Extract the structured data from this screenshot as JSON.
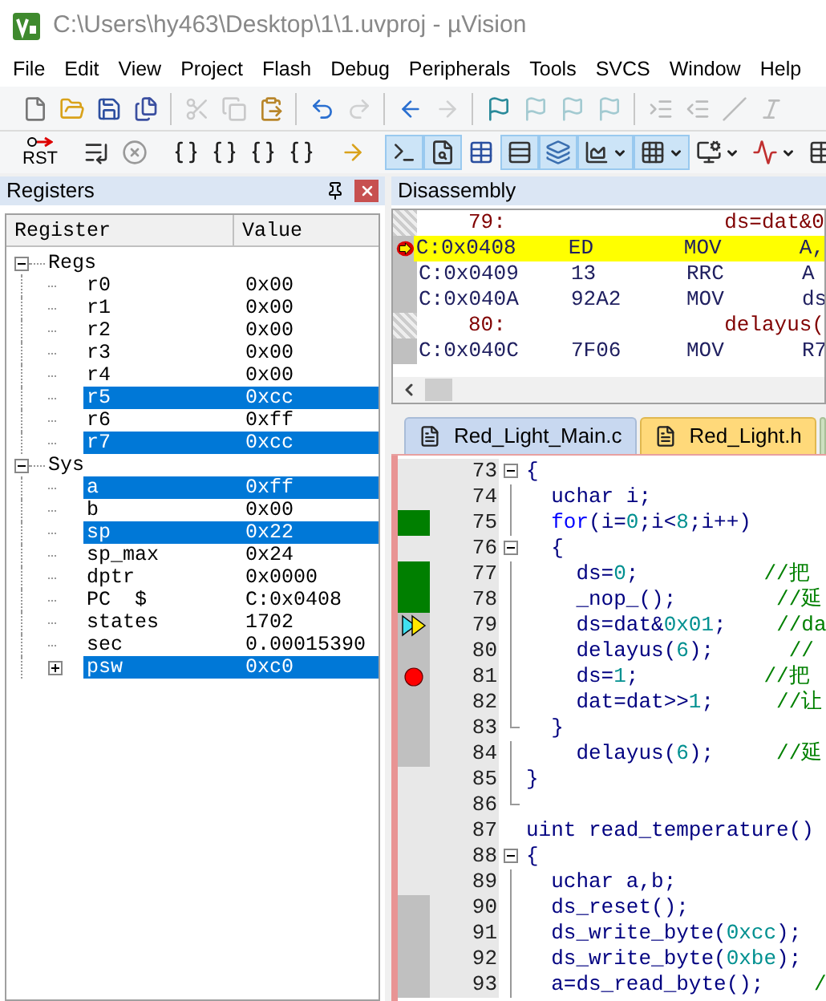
{
  "window": {
    "title": "C:\\Users\\hy463\\Desktop\\1\\1.uvproj - µVision"
  },
  "menu": [
    "File",
    "Edit",
    "View",
    "Project",
    "Flash",
    "Debug",
    "Peripherals",
    "Tools",
    "SVCS",
    "Window",
    "Help"
  ],
  "toolbar_1": [
    [
      {
        "kind": "new-file",
        "disabled": false
      },
      {
        "kind": "open-file",
        "disabled": false
      },
      {
        "kind": "save",
        "disabled": false
      },
      {
        "kind": "save-all",
        "disabled": false
      }
    ],
    [
      {
        "kind": "cut",
        "disabled": true
      },
      {
        "kind": "copy",
        "disabled": true
      },
      {
        "kind": "paste",
        "disabled": false
      }
    ],
    [
      {
        "kind": "undo",
        "disabled": false
      },
      {
        "kind": "redo",
        "disabled": true
      }
    ],
    [
      {
        "kind": "back",
        "disabled": false
      },
      {
        "kind": "forward",
        "disabled": true
      }
    ],
    [
      {
        "kind": "bookmark",
        "disabled": false
      },
      {
        "kind": "bookmark",
        "disabled": true
      },
      {
        "kind": "bookmark",
        "disabled": true
      },
      {
        "kind": "bookmark",
        "disabled": true
      }
    ],
    [
      {
        "kind": "indent",
        "disabled": true
      },
      {
        "kind": "outdent",
        "disabled": true
      },
      {
        "kind": "comment",
        "disabled": true
      },
      {
        "kind": "uncomment",
        "disabled": true
      }
    ]
  ],
  "toolbar_2": [
    [
      {
        "kind": "reset",
        "label": "RST",
        "selected": false
      }
    ],
    [
      {
        "kind": "step-list",
        "selected": false
      },
      {
        "kind": "stop",
        "selected": false
      }
    ],
    [
      {
        "kind": "step-in",
        "selected": false
      },
      {
        "kind": "step-over",
        "selected": false
      },
      {
        "kind": "step-out",
        "selected": false
      },
      {
        "kind": "run-to",
        "selected": false
      }
    ],
    [
      {
        "kind": "show-next",
        "selected": false
      }
    ],
    [
      {
        "kind": "command",
        "selected": true
      },
      {
        "kind": "disassembly",
        "selected": true
      },
      {
        "kind": "symbols",
        "selected": false
      },
      {
        "kind": "registers",
        "selected": true
      },
      {
        "kind": "call-stack",
        "selected": true
      },
      {
        "kind": "watch",
        "selected": true
      },
      {
        "kind": "memory",
        "selected": true
      },
      {
        "kind": "serial",
        "selected": false
      },
      {
        "kind": "analyzer",
        "selected": false
      },
      {
        "kind": "more",
        "selected": false
      }
    ]
  ],
  "registers": {
    "title": "Registers",
    "columns": [
      "Register",
      "Value"
    ],
    "groups": [
      {
        "name": "Regs",
        "expanded": true,
        "children": [
          {
            "name": "r0",
            "value": "0x00",
            "selected": false
          },
          {
            "name": "r1",
            "value": "0x00",
            "selected": false
          },
          {
            "name": "r2",
            "value": "0x00",
            "selected": false
          },
          {
            "name": "r3",
            "value": "0x00",
            "selected": false
          },
          {
            "name": "r4",
            "value": "0x00",
            "selected": false
          },
          {
            "name": "r5",
            "value": "0xcc",
            "selected": true
          },
          {
            "name": "r6",
            "value": "0xff",
            "selected": false
          },
          {
            "name": "r7",
            "value": "0xcc",
            "selected": true
          }
        ]
      },
      {
        "name": "Sys",
        "expanded": true,
        "children": [
          {
            "name": "a",
            "value": "0xff",
            "selected": true
          },
          {
            "name": "b",
            "value": "0x00",
            "selected": false
          },
          {
            "name": "sp",
            "value": "0x22",
            "selected": true
          },
          {
            "name": "sp_max",
            "value": "0x24",
            "selected": false
          },
          {
            "name": "dptr",
            "value": "0x0000",
            "selected": false
          },
          {
            "name": "PC  $",
            "value": "C:0x0408",
            "selected": false
          },
          {
            "name": "states",
            "value": "1702",
            "selected": false
          },
          {
            "name": "sec",
            "value": "0.00015390",
            "selected": false
          },
          {
            "name": "psw",
            "value": "0xc0",
            "selected": true,
            "expanded": false
          }
        ]
      }
    ]
  },
  "disassembly": {
    "title": "Disassembly",
    "rows": [
      {
        "kind": "source",
        "line": "79:",
        "text": "ds=dat&0"
      },
      {
        "kind": "instr",
        "address": "C:0x0408",
        "bytes": "ED",
        "mnemonic": "MOV",
        "operand": "A,",
        "current": true
      },
      {
        "kind": "instr",
        "address": "C:0x0409",
        "bytes": "13",
        "mnemonic": "RRC",
        "operand": "A",
        "current": false
      },
      {
        "kind": "instr",
        "address": "C:0x040A",
        "bytes": "92A2",
        "mnemonic": "MOV",
        "operand": "ds",
        "current": false
      },
      {
        "kind": "source",
        "line": "80:",
        "text": "delayus("
      },
      {
        "kind": "instr",
        "address": "C:0x040C",
        "bytes": "7F06",
        "mnemonic": "MOV",
        "operand": "R7",
        "current": false
      }
    ]
  },
  "tabs": [
    {
      "label": "Red_Light_Main.c",
      "selected": false
    },
    {
      "label": "Red_Light.h",
      "selected": true
    }
  ],
  "editor": {
    "lines": [
      {
        "number": "73",
        "covered": false,
        "executed": false,
        "kind": "fold-start",
        "tokens": [
          {
            "t": "{",
            "kind": "plain"
          }
        ]
      },
      {
        "number": "74",
        "covered": false,
        "executed": false,
        "kind": "fold-line",
        "tokens": [
          {
            "t": "  uchar i;",
            "kind": "plain"
          }
        ]
      },
      {
        "number": "75",
        "covered": true,
        "executed": true,
        "kind": "fold-line",
        "tokens": [
          {
            "t": "  for",
            "kind": "keyword"
          },
          {
            "t": "(i=",
            "kind": "plain"
          },
          {
            "t": "0",
            "kind": "number"
          },
          {
            "t": ";i<",
            "kind": "plain"
          },
          {
            "t": "8",
            "kind": "number"
          },
          {
            "t": ";i++)",
            "kind": "plain"
          }
        ]
      },
      {
        "number": "76",
        "covered": false,
        "executed": false,
        "kind": "fold-start",
        "tokens": [
          {
            "t": "  {",
            "kind": "plain"
          }
        ]
      },
      {
        "number": "77",
        "covered": true,
        "executed": true,
        "kind": "fold-line",
        "tokens": [
          {
            "t": "    ds=",
            "kind": "plain"
          },
          {
            "t": "0",
            "kind": "number"
          },
          {
            "t": ";          ",
            "kind": "plain"
          },
          {
            "t": "//把",
            "kind": "comment"
          }
        ]
      },
      {
        "number": "78",
        "covered": true,
        "executed": true,
        "kind": "fold-line",
        "tokens": [
          {
            "t": "    _nop_();        ",
            "kind": "plain"
          },
          {
            "t": "//延",
            "kind": "comment"
          }
        ]
      },
      {
        "number": "79",
        "covered": false,
        "executed": true,
        "kind": "fold-line",
        "current": true,
        "tokens": [
          {
            "t": "    ds=dat&",
            "kind": "plain"
          },
          {
            "t": "0x01",
            "kind": "number"
          },
          {
            "t": ";    ",
            "kind": "plain"
          },
          {
            "t": "//da",
            "kind": "comment"
          }
        ]
      },
      {
        "number": "80",
        "covered": false,
        "executed": true,
        "kind": "fold-line",
        "tokens": [
          {
            "t": "    delayus(",
            "kind": "plain"
          },
          {
            "t": "6",
            "kind": "number"
          },
          {
            "t": ");      ",
            "kind": "plain"
          },
          {
            "t": "//",
            "kind": "comment"
          }
        ]
      },
      {
        "number": "81",
        "covered": false,
        "executed": true,
        "kind": "fold-line",
        "breakpoint": true,
        "tokens": [
          {
            "t": "    ds=",
            "kind": "plain"
          },
          {
            "t": "1",
            "kind": "number"
          },
          {
            "t": ";          ",
            "kind": "plain"
          },
          {
            "t": "//把",
            "kind": "comment"
          }
        ]
      },
      {
        "number": "82",
        "covered": false,
        "executed": true,
        "kind": "fold-line",
        "tokens": [
          {
            "t": "    dat=dat>>",
            "kind": "plain"
          },
          {
            "t": "1",
            "kind": "number"
          },
          {
            "t": ";     ",
            "kind": "plain"
          },
          {
            "t": "//让",
            "kind": "comment"
          }
        ]
      },
      {
        "number": "83",
        "covered": false,
        "executed": true,
        "kind": "fold-end",
        "tokens": [
          {
            "t": "  }",
            "kind": "plain"
          }
        ]
      },
      {
        "number": "84",
        "covered": false,
        "executed": true,
        "kind": "fold-line",
        "tokens": [
          {
            "t": "    delayus(",
            "kind": "plain"
          },
          {
            "t": "6",
            "kind": "number"
          },
          {
            "t": ");     ",
            "kind": "plain"
          },
          {
            "t": "//延",
            "kind": "comment"
          }
        ]
      },
      {
        "number": "85",
        "covered": false,
        "executed": false,
        "kind": "fold-line",
        "tokens": [
          {
            "t": "}",
            "kind": "plain"
          }
        ]
      },
      {
        "number": "86",
        "covered": false,
        "executed": false,
        "kind": "fold-end"
      },
      {
        "number": "87",
        "covered": false,
        "executed": false,
        "kind": "plain",
        "tokens": [
          {
            "t": "uint read_temperature()",
            "kind": "plain"
          }
        ]
      },
      {
        "number": "88",
        "covered": false,
        "executed": false,
        "kind": "fold-start",
        "tokens": [
          {
            "t": "{",
            "kind": "plain"
          }
        ]
      },
      {
        "number": "89",
        "covered": false,
        "executed": false,
        "kind": "fold-line",
        "tokens": [
          {
            "t": "  uchar a,b;",
            "kind": "plain"
          }
        ]
      },
      {
        "number": "90",
        "covered": false,
        "executed": true,
        "kind": "fold-line",
        "tokens": [
          {
            "t": "  ds_reset();",
            "kind": "plain"
          }
        ]
      },
      {
        "number": "91",
        "covered": false,
        "executed": true,
        "kind": "fold-line",
        "tokens": [
          {
            "t": "  ds_write_byte(",
            "kind": "plain"
          },
          {
            "t": "0xcc",
            "kind": "number"
          },
          {
            "t": ");",
            "kind": "plain"
          }
        ]
      },
      {
        "number": "92",
        "covered": false,
        "executed": true,
        "kind": "fold-line",
        "tokens": [
          {
            "t": "  ds_write_byte(",
            "kind": "plain"
          },
          {
            "t": "0xbe",
            "kind": "number"
          },
          {
            "t": ");",
            "kind": "plain"
          }
        ]
      },
      {
        "number": "93",
        "covered": false,
        "executed": true,
        "kind": "fold-line",
        "tokens": [
          {
            "t": "  a=ds_read_byte();    ",
            "kind": "plain"
          },
          {
            "t": "/",
            "kind": "comment"
          }
        ]
      }
    ]
  }
}
